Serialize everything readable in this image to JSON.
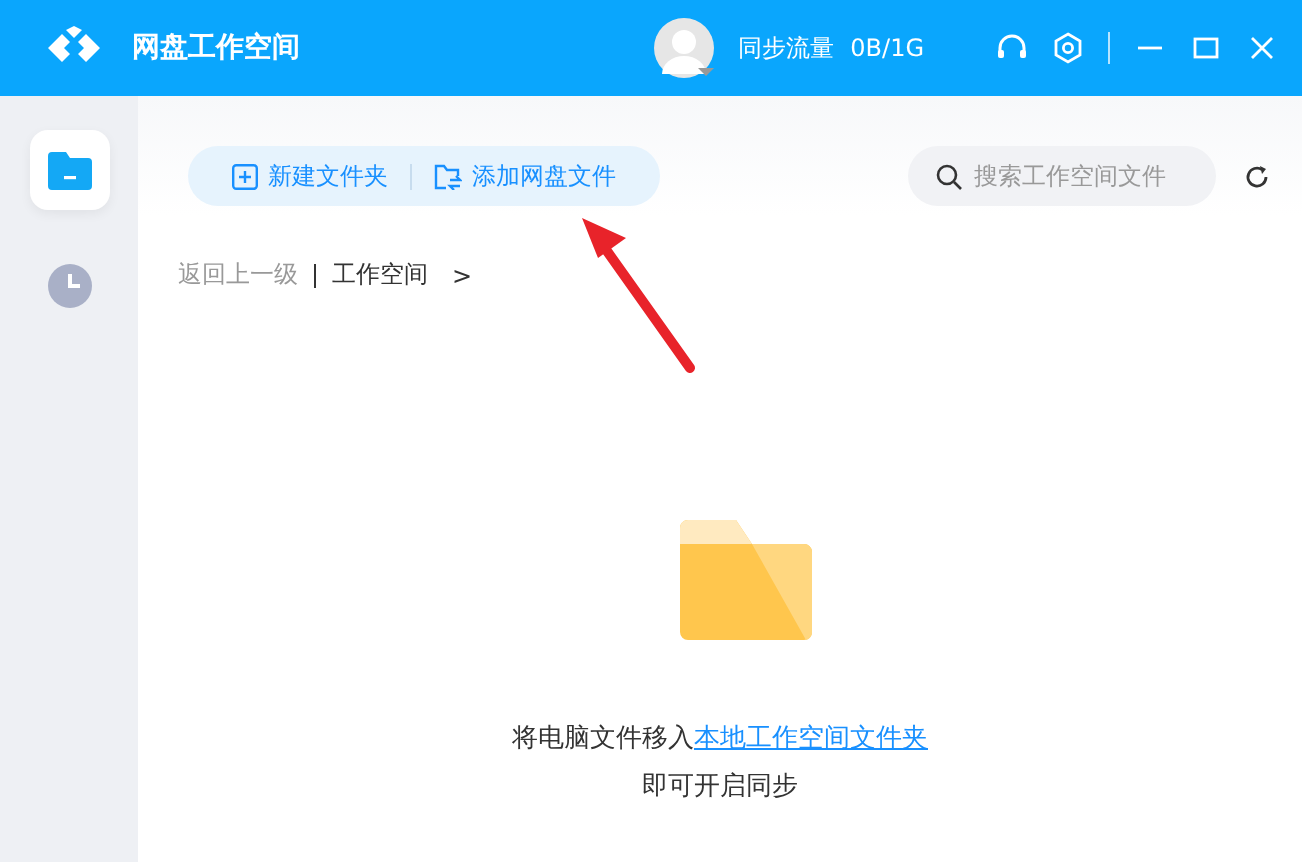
{
  "window": {
    "title": "网盘工作空间"
  },
  "traffic": {
    "label": "同步流量",
    "value": "0B/1G"
  },
  "sidebar": {
    "items": [
      {
        "kind": "folder",
        "selected": true
      },
      {
        "kind": "clock",
        "selected": false
      }
    ]
  },
  "toolbar": {
    "buttons": [
      {
        "kind": "new-folder",
        "label": "新建文件夹"
      },
      {
        "kind": "add-file",
        "label": "添加网盘文件"
      }
    ]
  },
  "search": {
    "placeholder": "搜索工作空间文件"
  },
  "breadcrumb": {
    "back": "返回上一级",
    "current": "工作空间",
    "separator": ">"
  },
  "empty": {
    "text": "将电脑文件移入",
    "link": "本地工作空间文件夹",
    "text2": "即可开启同步"
  }
}
